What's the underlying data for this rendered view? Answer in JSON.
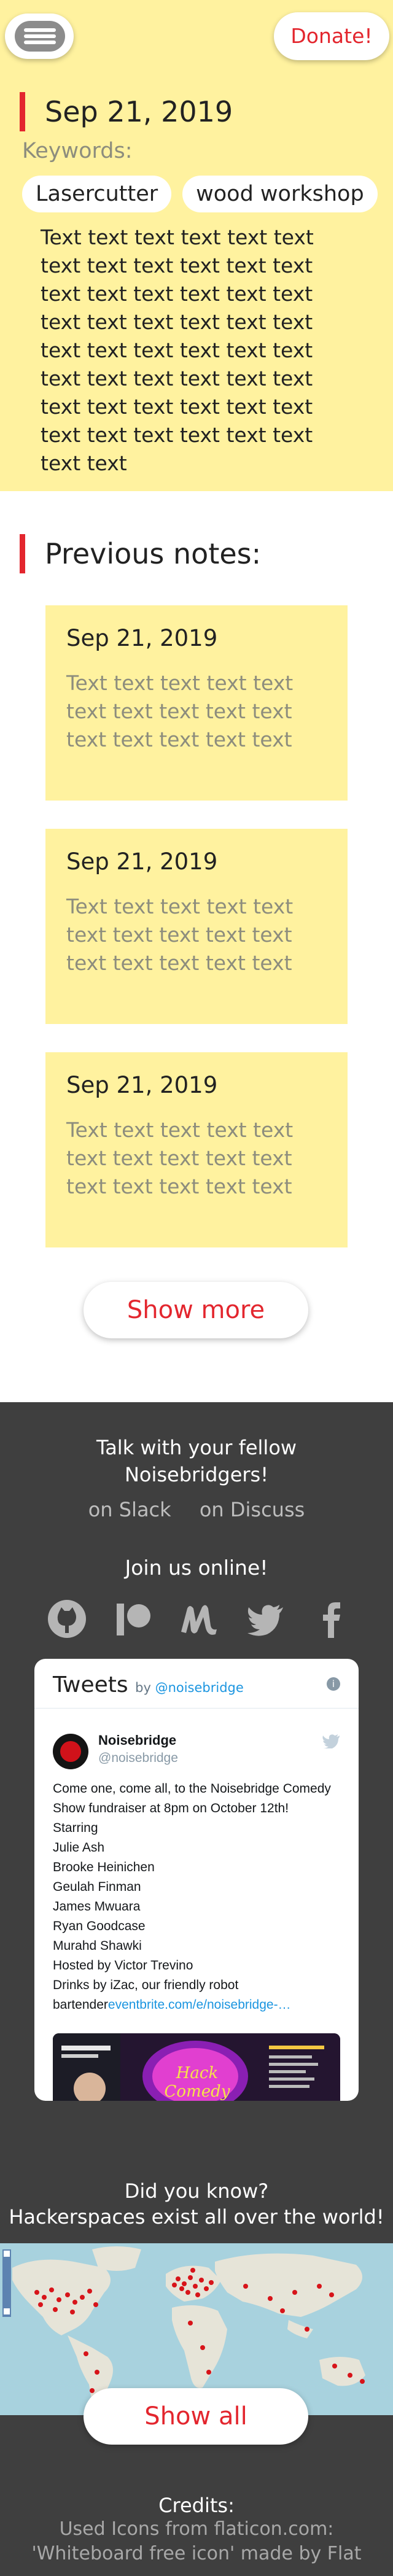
{
  "header": {
    "donate_label": "Donate!"
  },
  "current_note": {
    "date": "Sep 21, 2019",
    "keywords_label": "Keywords:",
    "keywords": [
      "Lasercutter",
      "wood workshop"
    ],
    "body": "Text text text text text text text text text text text text text text text text text text text text text text text text text text text text text text text text text text text text text text text text text text text text text text text text text text"
  },
  "previous": {
    "title": "Previous notes:",
    "notes": [
      {
        "date": "Sep 21, 2019",
        "text": "Text text text text text text text text text text text text text text text"
      },
      {
        "date": "Sep 21, 2019",
        "text": "Text text text text text text text text text text text text text text text"
      },
      {
        "date": "Sep 21, 2019",
        "text": "Text text text text text text text text text text text text text text text"
      }
    ],
    "show_more_label": "Show more"
  },
  "footer": {
    "talk_line1": "Talk with your fellow",
    "talk_line2": "Noisebridgers!",
    "slack_link": "on Slack",
    "discuss_link": "on Discuss",
    "join_label": "Join us online!",
    "social_icons": [
      "github-icon",
      "patreon-icon",
      "meetup-icon",
      "twitter-icon",
      "facebook-icon"
    ],
    "tweets": {
      "title": "Tweets",
      "by": "by",
      "handle_link": "@noisebridge",
      "info": "i",
      "author_name": "Noisebridge",
      "author_handle": "@noisebridge",
      "lines": [
        "Come one, come all, to the Noisebridge Comedy",
        "Show fundraiser at 8pm on October 12th!",
        "Starring",
        "Julie Ash",
        "Brooke Heinichen",
        "Geulah Finman",
        "James Mwuara",
        "Ryan Goodcase",
        "Murahd Shawki",
        "Hosted by Victor Trevino",
        "Drinks by iZac, our friendly robot"
      ],
      "last_line_prefix": "bartender",
      "last_line_link": "eventbrite.com/e/noisebridge-…",
      "image_title": "Hack Comedy"
    },
    "did_you_know_line1": "Did you know?",
    "did_you_know_line2": "Hackerspaces exist all over the world!",
    "show_all_label": "Show all",
    "credits_title": "Credits:",
    "credits_line1": "Used Icons from flaticon.com:",
    "credits_line2": "'Whiteboard free icon' made by Flat"
  },
  "colors": {
    "accent": "#e3262e",
    "note_bg": "#fff29f",
    "footer_bg": "#3f3f3f"
  }
}
